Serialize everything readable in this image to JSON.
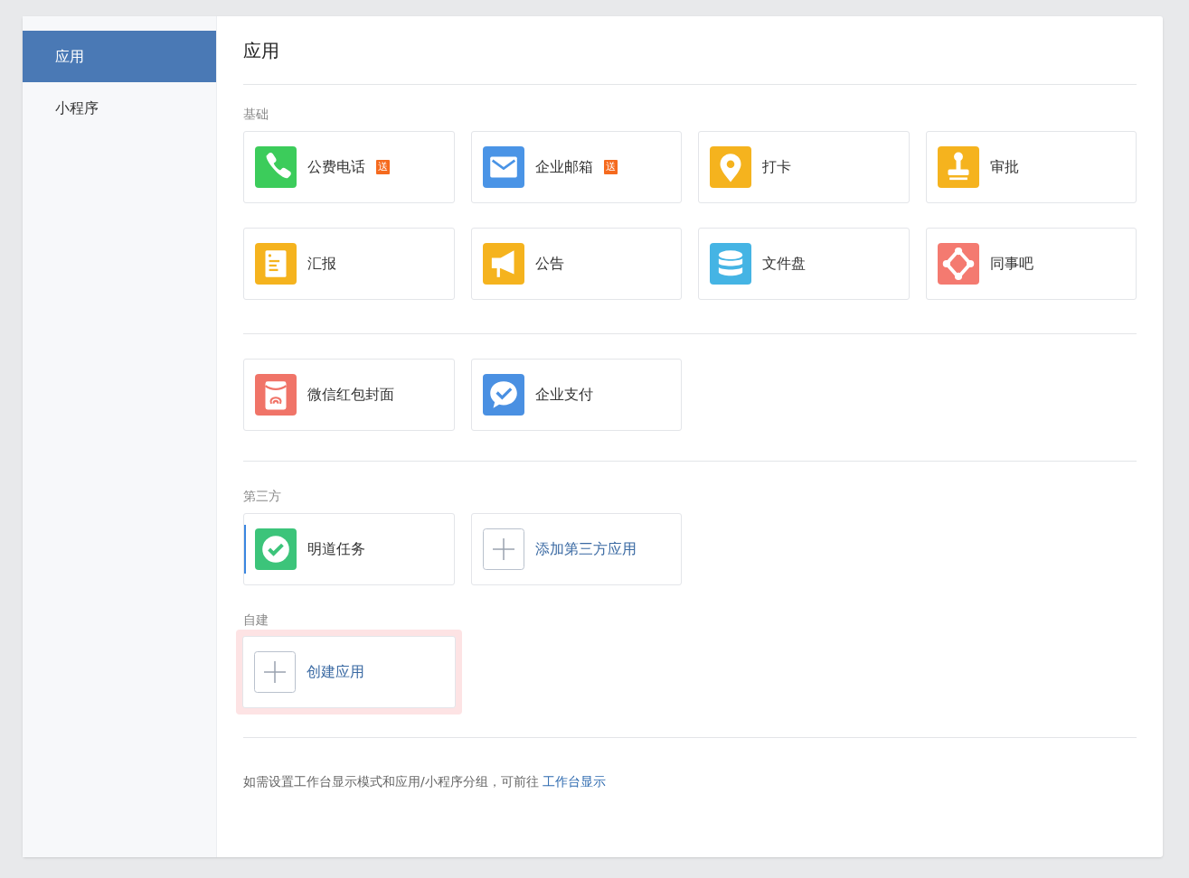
{
  "sidebar": {
    "items": [
      {
        "label": "应用",
        "selected": true
      },
      {
        "label": "小程序",
        "selected": false
      }
    ]
  },
  "main": {
    "title": "应用",
    "sections": [
      {
        "heading": "基础",
        "rule_after": true,
        "groups": [
          [
            {
              "kind": "phone",
              "label": "公费电话",
              "color": "#3ccc5b",
              "badge": "送"
            },
            {
              "kind": "mail",
              "label": "企业邮箱",
              "color": "#4a94e6",
              "badge": "送"
            },
            {
              "kind": "pin",
              "label": "打卡",
              "color": "#f5b31e"
            },
            {
              "kind": "stamp",
              "label": "审批",
              "color": "#f5b31e"
            },
            {
              "kind": "doc",
              "label": "汇报",
              "color": "#f5b31e"
            },
            {
              "kind": "megaphone",
              "label": "公告",
              "color": "#f5b31e"
            },
            {
              "kind": "database",
              "label": "文件盘",
              "color": "#45b4e4"
            },
            {
              "kind": "nodes",
              "label": "同事吧",
              "color": "#f47a70"
            }
          ],
          [
            {
              "kind": "envelope",
              "label": "微信红包封面",
              "color": "#f07468"
            },
            {
              "kind": "chat",
              "label": "企业支付",
              "color": "#4a90e2"
            }
          ]
        ]
      },
      {
        "heading": "第三方",
        "rule_after": false,
        "groups": [
          [
            {
              "kind": "check",
              "label": "明道任务",
              "color": "#3cc47a",
              "selected": true
            },
            {
              "kind": "add",
              "label": "添加第三方应用",
              "selected": false
            }
          ]
        ]
      },
      {
        "heading": "自建",
        "rule_after": true,
        "groups": [
          [
            {
              "kind": "add",
              "label": "创建应用",
              "highlighted": true
            }
          ]
        ]
      }
    ],
    "footer": {
      "text": "如需设置工作台显示模式和应用/小程序分组，可前往",
      "link": "工作台显示"
    }
  }
}
